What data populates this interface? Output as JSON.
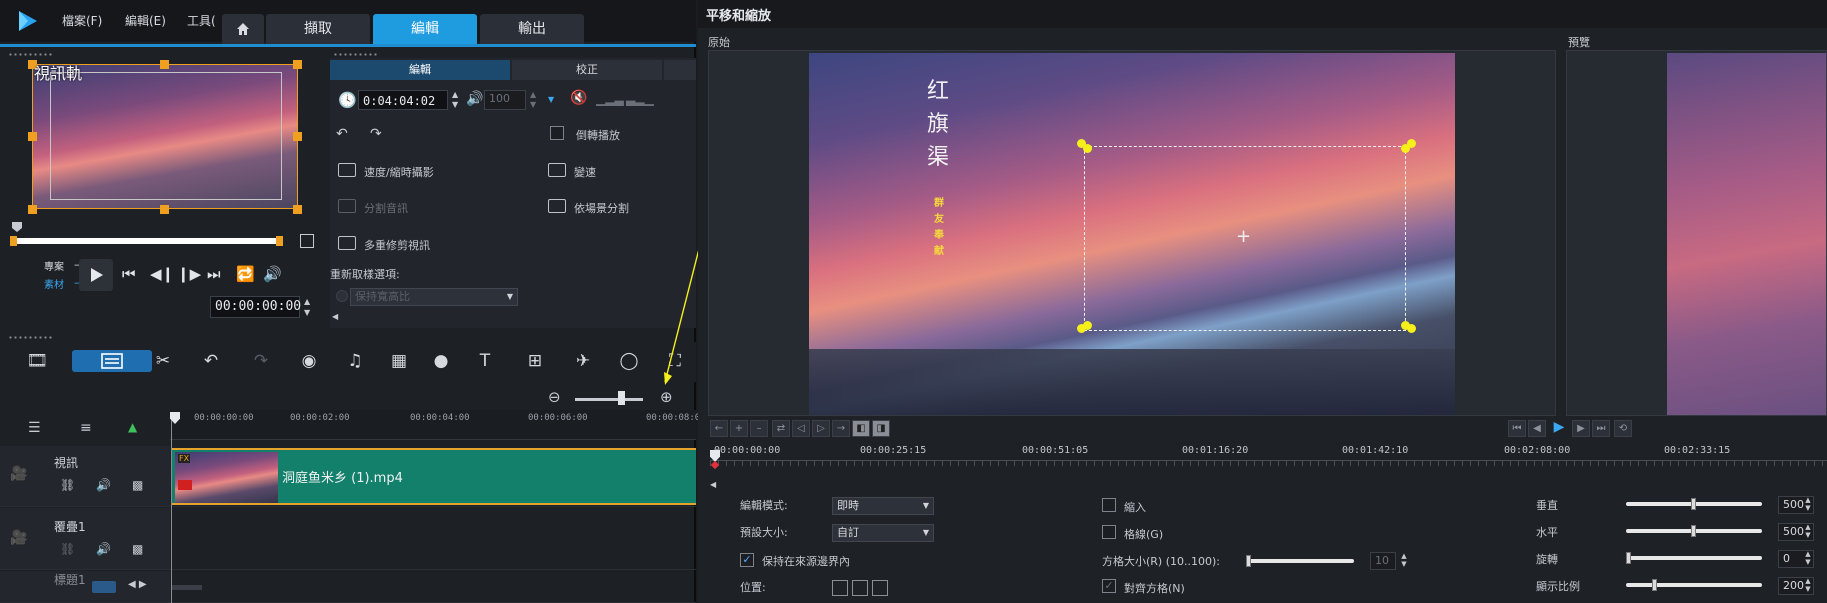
{
  "menu": {
    "file": "檔案(F)",
    "edit": "編輯(E)",
    "tools": "工具("
  },
  "steps": {
    "home_icon": "home-icon",
    "capture": "擷取",
    "edit": "編輯",
    "output": "輸出"
  },
  "preview": {
    "label": "視訊軌",
    "project_label": "專案",
    "clip_label": "素材",
    "timecode": "00:00:00:00"
  },
  "options": {
    "tab_edit": "編輯",
    "tab_correct": "校正",
    "duration": "0:04:04:02",
    "volume": "100",
    "reverse": "倒轉播放",
    "speed_timelapse": "速度/縮時攝影",
    "var_speed": "變速",
    "split_audio": "分割音訊",
    "split_scene": "依場景分割",
    "multi_trim": "多重修剪視訊",
    "resample_label": "重新取樣選項:",
    "resample_value": "保持寬高比"
  },
  "timeline": {
    "ruler": [
      "00:00:00:00",
      "00:00:02:00",
      "00:00:04:00",
      "00:00:06:00",
      "00:00:08:0"
    ],
    "tracks": [
      {
        "name": "視訊"
      },
      {
        "name": "覆疊1"
      },
      {
        "name": "標題1"
      }
    ],
    "clip_name": "洞庭鱼米乡 (1).mp4",
    "fx_badge": "FX"
  },
  "dialog": {
    "title": "平移和縮放",
    "original_label": "原始",
    "preview_label": "預覽",
    "calligraphy_main": "红旗渠",
    "calligraphy_sub": "群友奉献",
    "ruler": [
      "00:00:00:00",
      "00:00:25:15",
      "00:00:51:05",
      "00:01:16:20",
      "00:01:42:10",
      "00:02:08:00",
      "00:02:33:15"
    ],
    "edit_mode_label": "編輯模式:",
    "edit_mode_value": "即時",
    "preset_label": "預設大小:",
    "preset_value": "自訂",
    "keep_in_source": "保持在來源邊界內",
    "position_label": "位置:",
    "zoom_in_label": "縮入",
    "grid_label": "格線(G)",
    "grid_size_label": "方格大小(R) (10..100):",
    "grid_size_value": "10",
    "snap_grid": "對齊方格(N)",
    "vertical_label": "垂直",
    "vertical_value": "500",
    "horizontal_label": "水平",
    "horizontal_value": "500",
    "rotate_label": "旋轉",
    "rotate_value": "0",
    "zoom_label": "顯示比例",
    "zoom_value": "200",
    "vertical_level": 0.5,
    "horizontal_level": 0.5,
    "rotate_level": 0.0,
    "zoom_level": 0.2
  },
  "colors": {
    "accent": "#1f9be0",
    "handle": "#f5ef1a",
    "clip": "#12806a"
  }
}
